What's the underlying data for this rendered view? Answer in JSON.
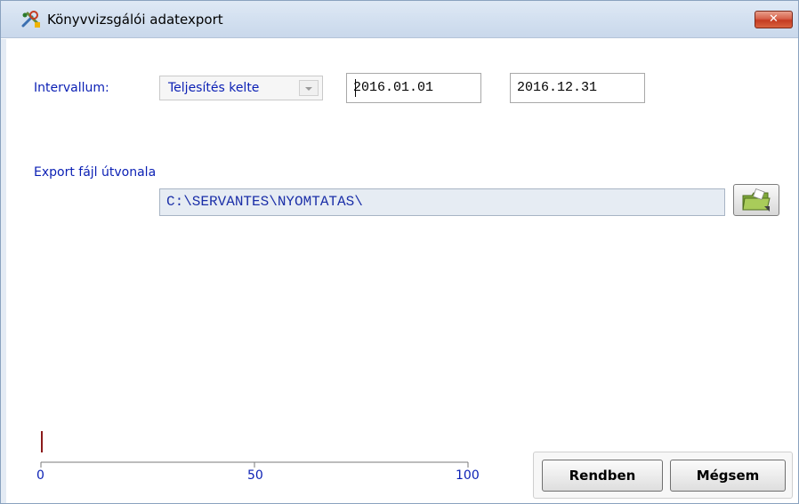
{
  "window": {
    "title": "Könyvvizsgálói adatexport",
    "close_label": "✕"
  },
  "interval": {
    "label": "Intervallum:",
    "type_value": "Teljesítés kelte",
    "date_from": "2016.01.01",
    "date_to": "2016.12.31"
  },
  "export": {
    "label": "Export fájl útvonala",
    "path": "C:\\SERVANTES\\NYOMTATAS\\"
  },
  "progress": {
    "value": 0,
    "ticks": [
      "0",
      "50",
      "100"
    ]
  },
  "buttons": {
    "ok_label": "Rendben",
    "cancel_label": "Mégsem"
  },
  "colors": {
    "label_blue": "#0a1fb4",
    "progress_marker": "#8b1a1a"
  },
  "icons": {
    "app": "tools-icon",
    "browse": "folder-icon",
    "close": "close-icon",
    "dropdown": "chevron-down-icon"
  }
}
